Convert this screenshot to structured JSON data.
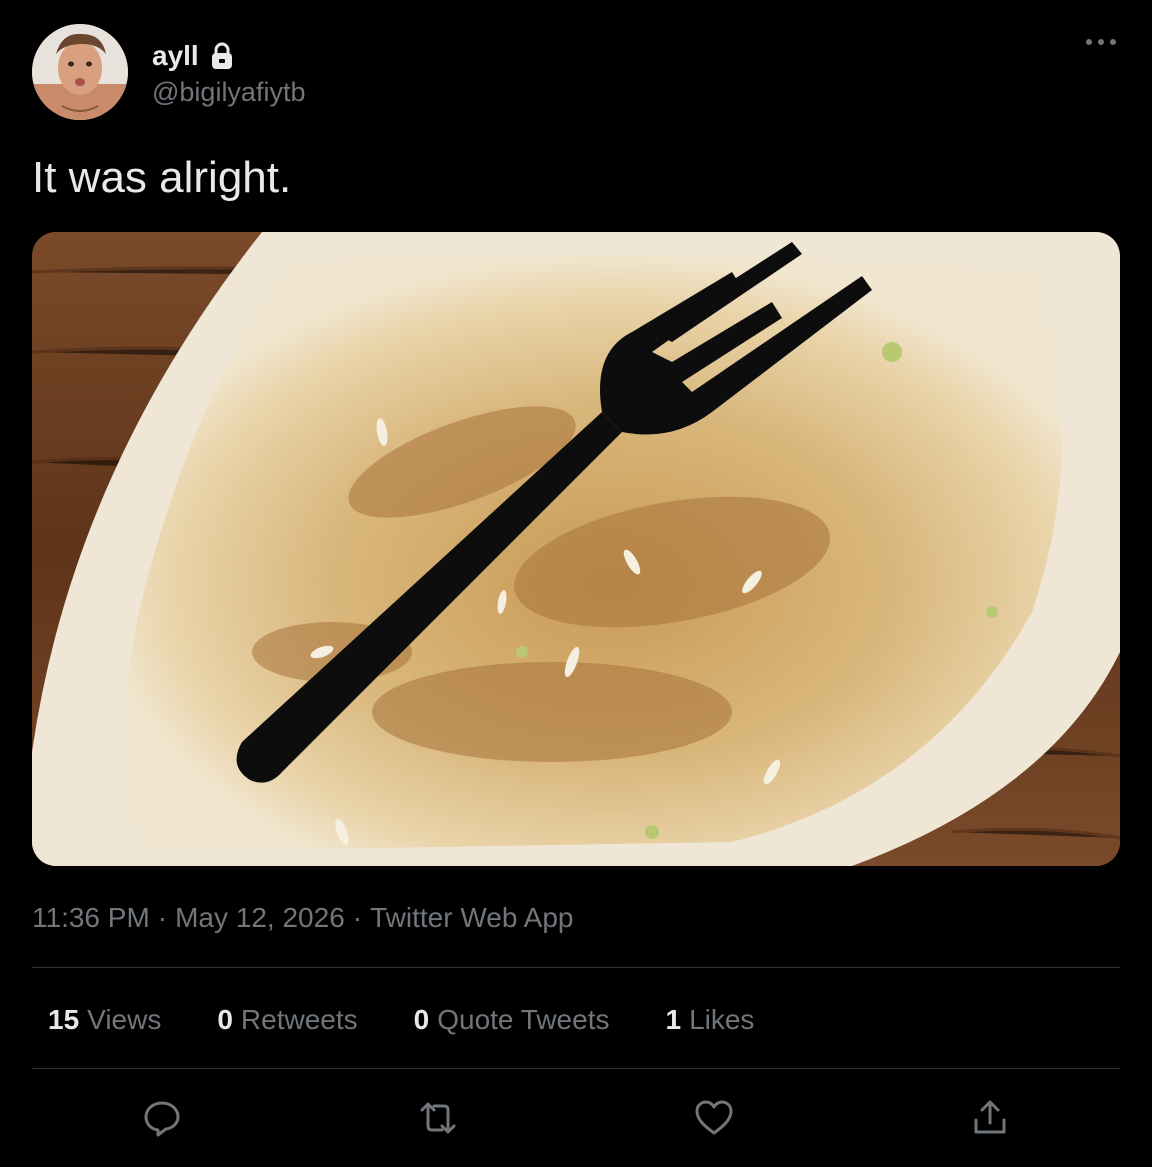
{
  "author": {
    "display_name": "ayll",
    "handle": "@bigilyafiytb",
    "avatar_icon": "user-avatar",
    "locked_icon": "lock-icon"
  },
  "tweet": {
    "text": "It was alright.",
    "media_description_icon": "photo"
  },
  "meta": {
    "time": "11:36 PM",
    "date": "May 12, 2026",
    "source": "Twitter Web App",
    "separator": "·"
  },
  "stats": [
    {
      "count": "15",
      "label": "Views"
    },
    {
      "count": "0",
      "label": "Retweets"
    },
    {
      "count": "0",
      "label": "Quote Tweets"
    },
    {
      "count": "1",
      "label": "Likes"
    }
  ],
  "actions": [
    {
      "name": "reply",
      "icon": "reply-icon"
    },
    {
      "name": "retweet",
      "icon": "retweet-icon"
    },
    {
      "name": "like",
      "icon": "heart-icon"
    },
    {
      "name": "share",
      "icon": "share-icon"
    }
  ],
  "colors": {
    "background": "#000000",
    "text_primary": "#e7e9ea",
    "text_secondary": "#71767b",
    "divider": "#2f3336"
  }
}
